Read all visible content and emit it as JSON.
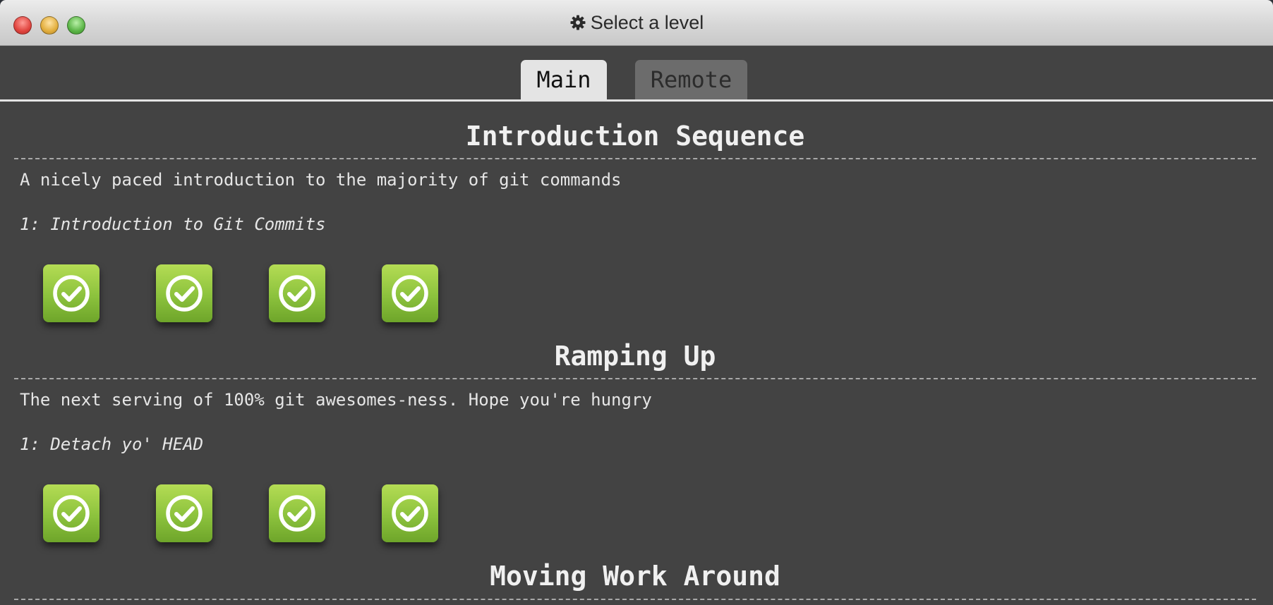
{
  "window": {
    "title": "Select a level"
  },
  "tabs": [
    {
      "label": "Main",
      "active": true
    },
    {
      "label": "Remote",
      "active": false
    }
  ],
  "sections": [
    {
      "title": "Introduction Sequence",
      "description": "A nicely paced introduction to the majority of git commands",
      "level_name": "1: Introduction to Git Commits",
      "levels": [
        {
          "status": "completed",
          "icon": "check-circle-icon"
        },
        {
          "status": "completed",
          "icon": "check-circle-icon"
        },
        {
          "status": "completed",
          "icon": "check-circle-icon"
        },
        {
          "status": "completed",
          "icon": "check-circle-icon"
        }
      ]
    },
    {
      "title": "Ramping Up",
      "description": "The next serving of 100% git awesomes-ness. Hope you're hungry",
      "level_name": "1: Detach yo' HEAD",
      "levels": [
        {
          "status": "completed",
          "icon": "check-circle-icon"
        },
        {
          "status": "completed",
          "icon": "check-circle-icon"
        },
        {
          "status": "completed",
          "icon": "check-circle-icon"
        },
        {
          "status": "completed",
          "icon": "check-circle-icon"
        }
      ]
    },
    {
      "title": "Moving Work Around"
    }
  ],
  "colors": {
    "background": "#434343",
    "level_complete": "#8cc23d",
    "tab_active": "#e4e4e4",
    "tab_inactive": "#6c6c6c"
  }
}
